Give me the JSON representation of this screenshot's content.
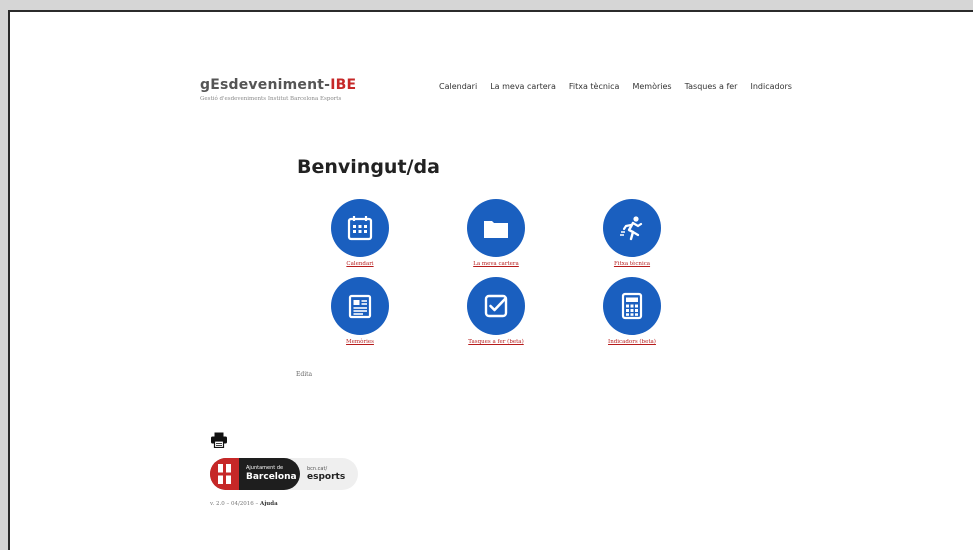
{
  "logo": {
    "title_main": "gEsdeveniment-",
    "title_accent": "IBE",
    "subtitle": "Gestió d'esdeveniments Institut Barcelona Esports"
  },
  "nav": {
    "items": [
      "Calendari",
      "La meva cartera",
      "Fitxa tècnica",
      "Memòries",
      "Tasques a fer",
      "Indicadors"
    ]
  },
  "main": {
    "heading": "Benvingut/da",
    "tiles": [
      {
        "label": "Calendari",
        "icon": "calendar-icon"
      },
      {
        "label": "La meva cartera",
        "icon": "folder-icon"
      },
      {
        "label": "Fitxa tècnica",
        "icon": "runner-icon"
      },
      {
        "label": "Memòries",
        "icon": "newspaper-icon"
      },
      {
        "label": "Tasques a fer (beta)",
        "icon": "checkbox-icon"
      },
      {
        "label": "Indicadors (beta)",
        "icon": "calculator-icon"
      }
    ],
    "edit_link": "Edita"
  },
  "footer": {
    "print_icon": "printer-icon",
    "badge": {
      "line1": "Ajuntament de",
      "line2": "Barcelona",
      "line3": "bcn.cat/",
      "line4": "esports"
    },
    "version": "v. 2.0 – 04/2016 – ",
    "help": "Ajuda"
  },
  "colors": {
    "accent_blue": "#1a5fbf",
    "accent_red": "#c62828"
  }
}
